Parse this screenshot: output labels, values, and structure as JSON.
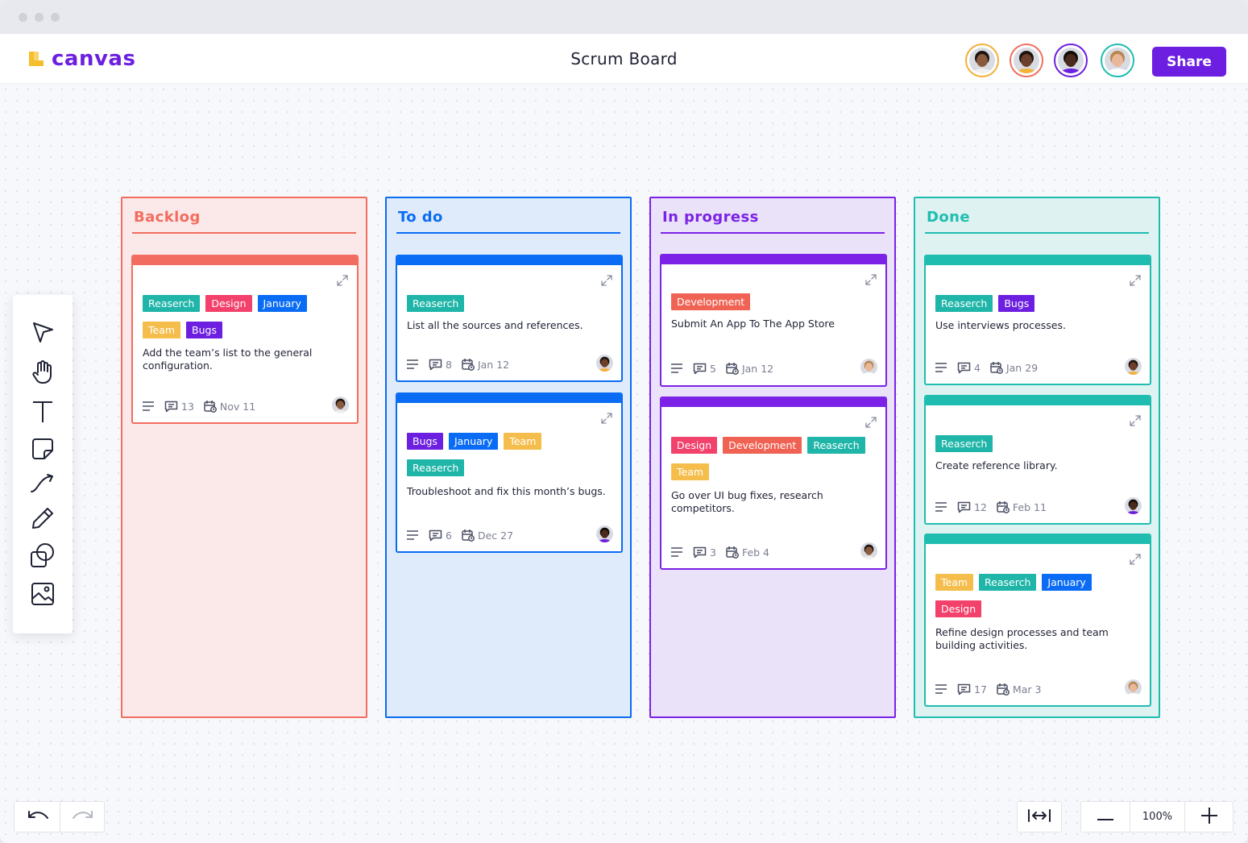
{
  "app": {
    "logo_text": "canvas",
    "title": "Scrum Board",
    "share_label": "Share",
    "brand_color": "#6c1fe0"
  },
  "collaborators": [
    {
      "name": "avatar-1",
      "ring": "#f2b13c"
    },
    {
      "name": "avatar-2",
      "ring": "#f0705f"
    },
    {
      "name": "avatar-3",
      "ring": "#6c1fe0"
    },
    {
      "name": "avatar-4",
      "ring": "#1fbdb0"
    }
  ],
  "tools": [
    "select-tool",
    "hand-tool",
    "text-tool",
    "sticky-note-tool",
    "connector-tool",
    "pen-tool",
    "shapes-tool",
    "image-tool"
  ],
  "tag_colors": {
    "Reaserch": "#1fb5a8",
    "Design": "#f2416b",
    "January": "#0a6cf5",
    "Team": "#f5be4c",
    "Bugs": "#6c1fe0",
    "Development": "#f06354"
  },
  "columns": [
    {
      "title": "Backlog",
      "color": "#f26d5f",
      "bg": "#fbe9e9",
      "cards": [
        {
          "tags": [
            [
              "Reaserch",
              "Design",
              "January"
            ],
            [
              "Team",
              "Bugs"
            ]
          ],
          "text": "Add the team’s list to the general configuration.",
          "comments": "13",
          "date": "Nov 11"
        }
      ]
    },
    {
      "title": "To do",
      "color": "#0a6cf5",
      "bg": "#dfebfa",
      "cards": [
        {
          "tags": [
            [
              "Reaserch"
            ]
          ],
          "text": "List all the sources and references.",
          "comments": "8",
          "date": "Jan 12"
        },
        {
          "tags": [
            [
              "Bugs",
              "January",
              "Team"
            ],
            [
              "Reaserch"
            ]
          ],
          "text": "Troubleshoot and fix this month’s bugs.",
          "comments": "6",
          "date": "Dec 27"
        }
      ]
    },
    {
      "title": "In progress",
      "color": "#7b22e6",
      "bg": "#e9e2f8",
      "cards": [
        {
          "tags": [
            [
              "Development"
            ]
          ],
          "text": "Submit An App To The App Store",
          "comments": "5",
          "date": "Jan 12"
        },
        {
          "tags": [
            [
              "Design",
              "Development",
              "Reaserch"
            ],
            [
              "Team"
            ]
          ],
          "text": "Go over UI bug fixes, research competitors.",
          "comments": "3",
          "date": "Feb 4"
        }
      ]
    },
    {
      "title": "Done",
      "color": "#1fbdb0",
      "bg": "#def3f1",
      "cards": [
        {
          "tags": [
            [
              "Reaserch",
              "Bugs"
            ]
          ],
          "text": "Use interviews processes.",
          "comments": "4",
          "date": "Jan 29"
        },
        {
          "tags": [
            [
              "Reaserch"
            ]
          ],
          "text": "Create reference library.",
          "comments": "12",
          "date": "Feb 11"
        },
        {
          "tags": [
            [
              "Team",
              "Reaserch",
              "January"
            ],
            [
              "Design"
            ]
          ],
          "text": "Refine design processes and team building activities.",
          "comments": "17",
          "date": "Mar 3"
        }
      ]
    }
  ],
  "zoom": {
    "value": "100%"
  }
}
